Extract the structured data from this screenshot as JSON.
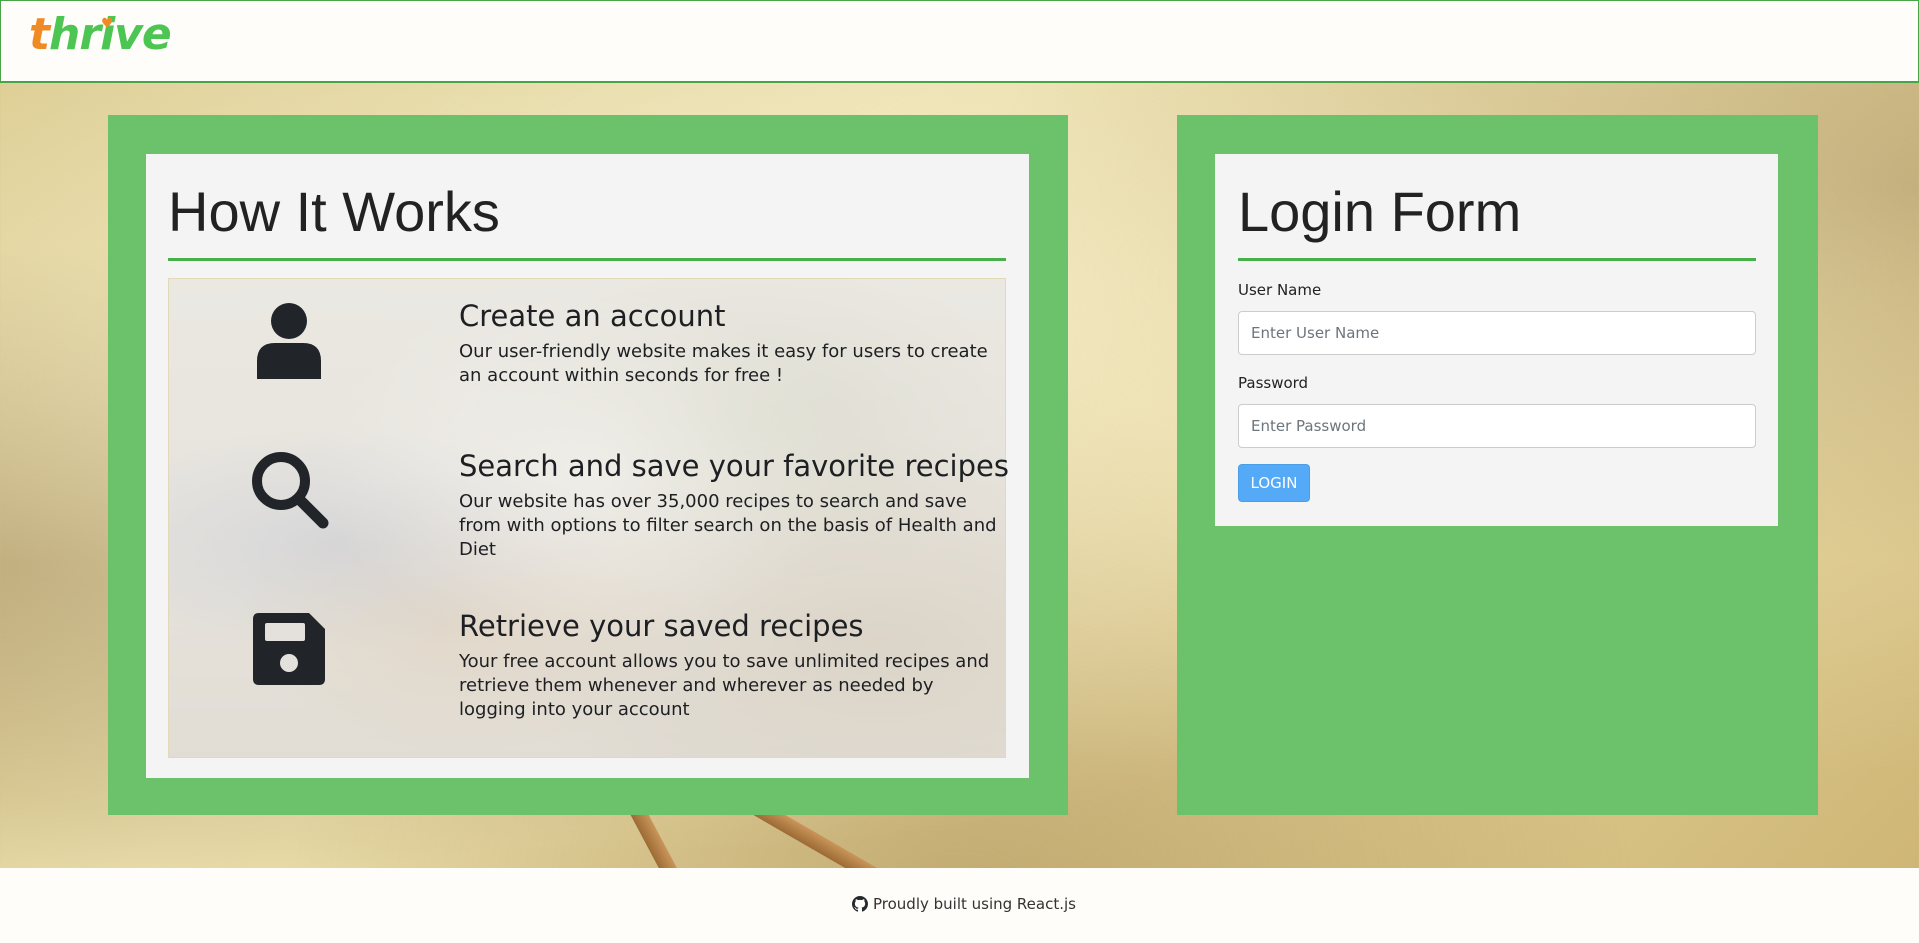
{
  "header": {
    "logo_first": "t",
    "logo_rest": "hrive"
  },
  "how_it_works": {
    "title": "How It Works",
    "steps": [
      {
        "icon": "user-icon",
        "title": "Create an account",
        "description": "Our user-friendly website makes it easy for users to create an account within seconds for free !"
      },
      {
        "icon": "search-icon",
        "title": "Search and save your favorite recipes",
        "description": "Our website has over 35,000 recipes to search and save from with options to filter search on the basis of Health and Diet"
      },
      {
        "icon": "save-icon",
        "title": "Retrieve your saved recipes",
        "description": "Your free account allows you to save unlimited recipes and retrieve them whenever and wherever as needed by logging into your account"
      }
    ]
  },
  "login_form": {
    "title": "Login Form",
    "username_label": "User Name",
    "username_placeholder": "Enter User Name",
    "password_label": "Password",
    "password_placeholder": "Enter Password",
    "login_button": "LOGIN"
  },
  "footer": {
    "text": "Proudly built using React.js",
    "icon": "github-icon"
  },
  "colors": {
    "brand_green": "#4cc552",
    "brand_orange": "#f08a24",
    "panel_green": "#6cc26a",
    "accent_rule": "#47b04a",
    "login_button": "#55aaf7"
  }
}
